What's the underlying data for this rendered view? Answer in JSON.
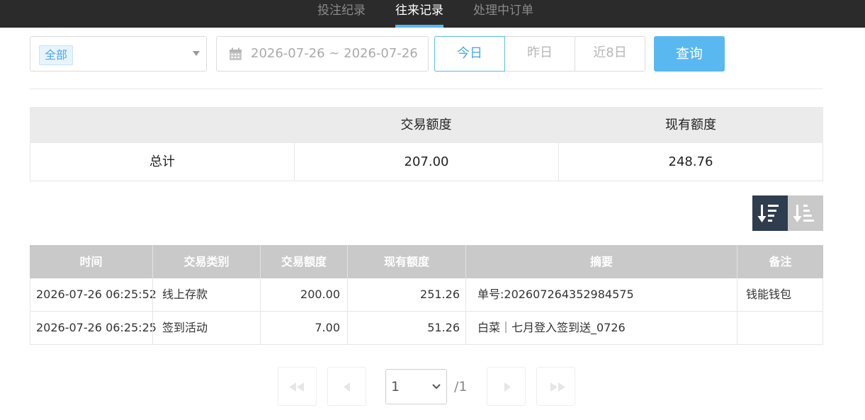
{
  "tabs": [
    {
      "label": "投注纪录",
      "active": false
    },
    {
      "label": "往来记录",
      "active": true
    },
    {
      "label": "处理中订单",
      "active": false
    }
  ],
  "filter": {
    "type_tag": "全部",
    "date_range": "2026-07-26 ~ 2026-07-26",
    "quick_ranges": [
      "今日",
      "昨日",
      "近8日"
    ],
    "active_range": "今日",
    "query_label": "查询"
  },
  "summary": {
    "headers": [
      "",
      "交易额度",
      "现有额度"
    ],
    "row": {
      "label": "总计",
      "trade_amount": "207.00",
      "current_amount": "248.76"
    }
  },
  "sort": {
    "desc_icon": "sort-descending-icon",
    "asc_icon": "sort-ascending-icon",
    "active": "desc"
  },
  "table": {
    "headers": [
      "时间",
      "交易类别",
      "交易额度",
      "现有额度",
      "摘要",
      "备注"
    ],
    "rows": [
      {
        "time": "2026-07-26 06:25:52",
        "type": "线上存款",
        "amount": "200.00",
        "balance": "251.26",
        "summary": "单号:202607264352984575",
        "note": "钱能钱包"
      },
      {
        "time": "2026-07-26 06:25:25",
        "type": "签到活动",
        "amount": "7.00",
        "balance": "51.26",
        "summary": "白菜｜七月登入签到送_0726",
        "note": ""
      }
    ]
  },
  "pagination": {
    "current_page": "1",
    "total": "/1",
    "icons": [
      "first-page-icon",
      "prev-page-icon",
      "next-page-icon",
      "last-page-icon"
    ]
  },
  "colors": {
    "accent": "#5ab8f0",
    "topbar": "#2b2b2b",
    "header_gray": "#c9c9c9",
    "sort_active": "#2f3d4e"
  }
}
